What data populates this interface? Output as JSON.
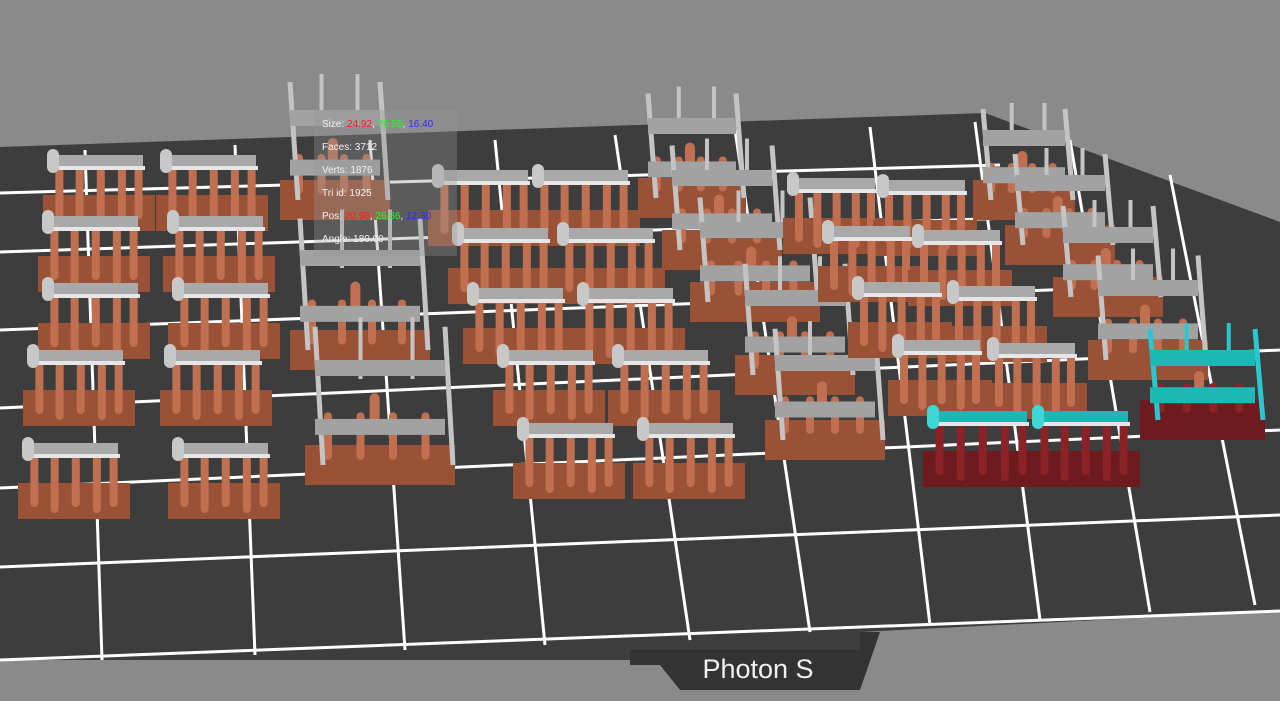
{
  "viewport": {
    "printer_label": "Photon S",
    "colors": {
      "background": "#8a8a8a",
      "plate": "#3d3d3d",
      "grid": "#ffffff",
      "support": "#c07050",
      "model": "#a9a9a9",
      "selected_model": "#1fb6b6",
      "selected_support": "#8a2228"
    }
  },
  "info": {
    "size_label": "Size:",
    "size_x": "24.92",
    "size_y": "76.95",
    "size_z": "16.40",
    "faces": "Faces: 3712",
    "verts": "Verts: 1876",
    "tri_id": "Tri id: 1925",
    "pos_label": "Pos:",
    "pos_x": "20.98",
    "pos_y": "26.86",
    "pos_z": "12.30",
    "angle": "Angle: 180.00"
  }
}
